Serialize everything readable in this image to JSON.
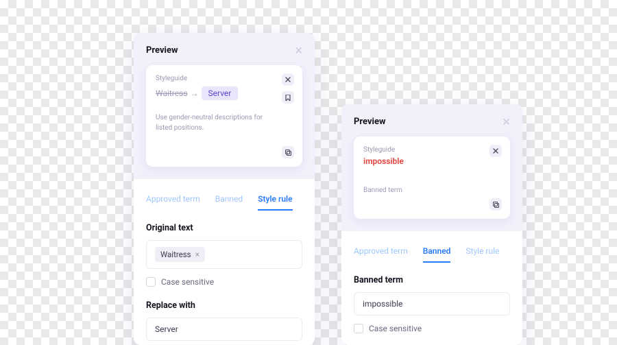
{
  "panelA": {
    "preview_title": "Preview",
    "styleguide_label": "Styleguide",
    "original_word": "Waitress",
    "arrow": "→",
    "replacement_word": "Server",
    "description": "Use gender-neutral descriptions for listed positions.",
    "tabs": {
      "approved": "Approved term",
      "banned": "Banned",
      "style": "Style rule"
    },
    "section_original": "Original text",
    "chip_original": "Waitress",
    "case_sensitive": "Case sensitive",
    "section_replace": "Replace with",
    "replace_value": "Server"
  },
  "panelB": {
    "preview_title": "Preview",
    "styleguide_label": "Styleguide",
    "banned_word": "impossible",
    "banned_small": "Banned term",
    "tabs": {
      "approved": "Approved term",
      "banned": "Banned",
      "style": "Style rule"
    },
    "section_banned": "Banned term",
    "banned_value": "impossible",
    "case_sensitive": "Case sensitive"
  }
}
